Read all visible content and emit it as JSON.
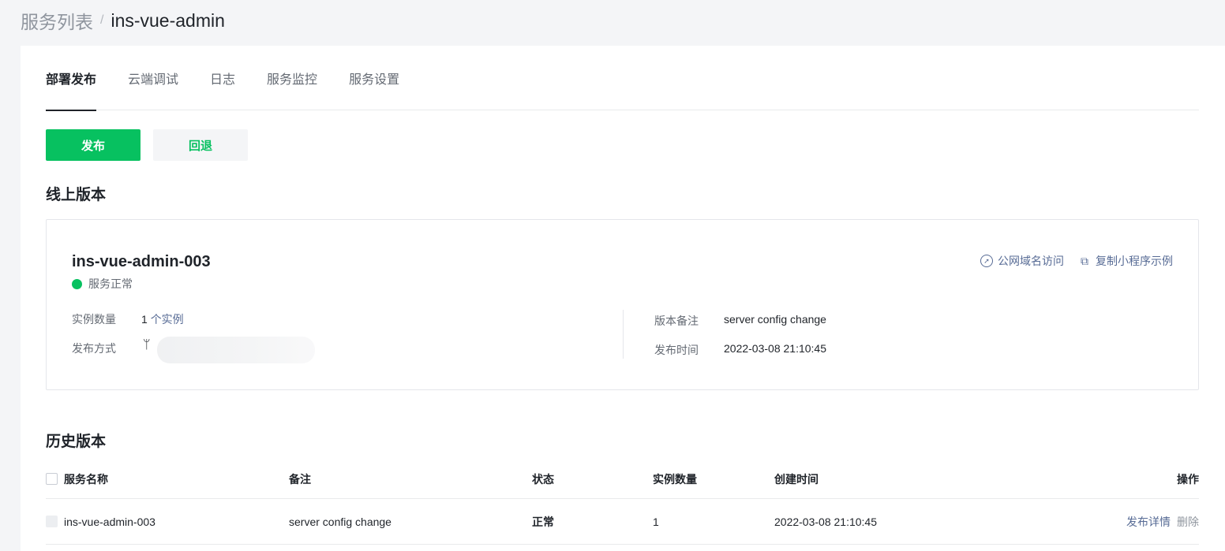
{
  "breadcrumb": {
    "parent": "服务列表",
    "separator": "/",
    "current": "ins-vue-admin"
  },
  "tabs": [
    {
      "label": "部署发布",
      "active": true
    },
    {
      "label": "云端调试",
      "active": false
    },
    {
      "label": "日志",
      "active": false
    },
    {
      "label": "服务监控",
      "active": false
    },
    {
      "label": "服务设置",
      "active": false
    }
  ],
  "buttons": {
    "publish": "发布",
    "rollback": "回退"
  },
  "online": {
    "section_title": "线上版本",
    "name": "ins-vue-admin-003",
    "status": "服务正常",
    "status_color": "#07c160",
    "actions": [
      {
        "icon": "compass-icon",
        "label": "公网域名访问"
      },
      {
        "icon": "copy-icon",
        "label": "复制小程序示例"
      }
    ],
    "instance_label": "实例数量",
    "instance_count": "1",
    "instance_link": "个实例",
    "deploy_label": "发布方式",
    "deploy_icon": "git-branch-icon",
    "remark_label": "版本备注",
    "remark_value": "server config change",
    "time_label": "发布时间",
    "time_value": "2022-03-08 21:10:45"
  },
  "history": {
    "section_title": "历史版本",
    "columns": [
      "服务名称",
      "备注",
      "状态",
      "实例数量",
      "创建时间",
      "操作"
    ],
    "rows": [
      {
        "name": "ins-vue-admin-003",
        "remark": "server config change",
        "status": "正常",
        "instances": "1",
        "created": "2022-03-08 21:10:45",
        "op_detail": "发布详情",
        "op_delete": "删除"
      }
    ]
  },
  "colors": {
    "accent": "#07c160",
    "link": "#576b95"
  }
}
